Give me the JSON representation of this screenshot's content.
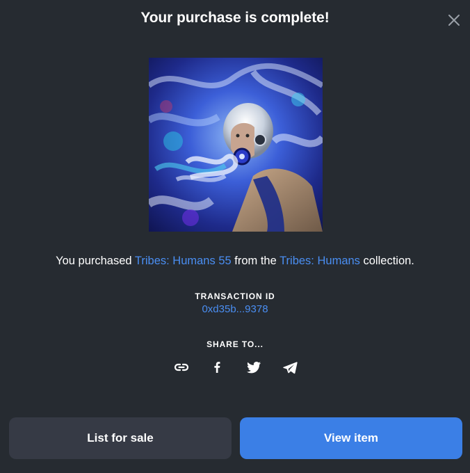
{
  "modal": {
    "title": "Your purchase is complete!"
  },
  "purchase": {
    "prefix": "You purchased ",
    "item_name": "Tribes: Humans 55",
    "middle": " from the ",
    "collection_name": "Tribes: Humans",
    "suffix": " collection."
  },
  "transaction": {
    "label": "TRANSACTION ID",
    "id": "0xd35b...9378"
  },
  "share": {
    "label": "SHARE TO...",
    "targets": [
      "link-icon",
      "facebook-icon",
      "twitter-icon",
      "telegram-icon"
    ]
  },
  "actions": {
    "list_for_sale": "List for sale",
    "view_item": "View item"
  },
  "colors": {
    "background": "#262b31",
    "accent": "#3b7fe6",
    "link": "#4a8ef2",
    "secondary_button": "#363a45"
  }
}
